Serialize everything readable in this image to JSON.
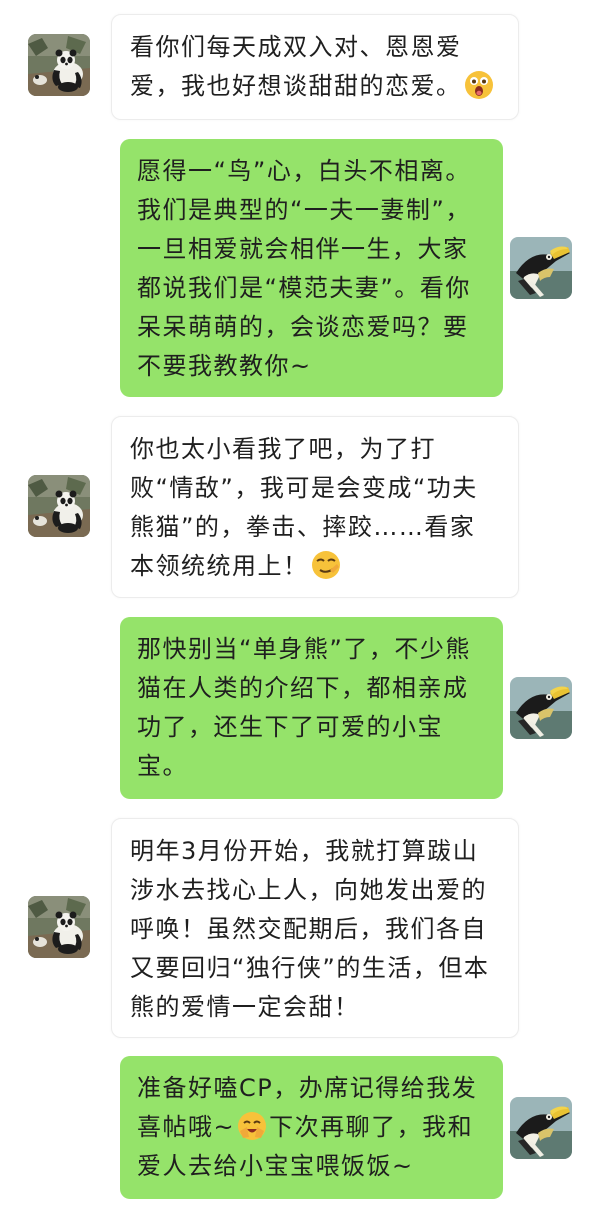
{
  "colors": {
    "incoming_bubble": "#ffffff",
    "outgoing_bubble": "#95e36a",
    "text": "#1f1f1f"
  },
  "participants": {
    "panda": {
      "avatar_icon": "panda-avatar-icon"
    },
    "hornbill": {
      "avatar_icon": "hornbill-avatar-icon"
    }
  },
  "messages": [
    {
      "sender": "panda",
      "side": "left",
      "text": "看你们每天成双入对、恩恩爱爱，我也好想谈甜甜的恋爱。",
      "emoji": "surprised-face-emoji"
    },
    {
      "sender": "hornbill",
      "side": "right",
      "text": "愿得一“鸟”心，白头不相离。我们是典型的“一夫一妻制”，一旦相爱就会相伴一生，大家都说我们是“模范夫妻”。看你呆呆萌萌的，会谈恋爱吗？要不要我教教你~"
    },
    {
      "sender": "panda",
      "side": "left",
      "text": "你也太小看我了吧，为了打败“情敌”，我可是会变成“功夫熊猫”的，拳击、摔跤……看家本领统统用上！",
      "emoji": "smug-face-emoji"
    },
    {
      "sender": "hornbill",
      "side": "right",
      "text": "那快别当“单身熊”了，不少熊猫在人类的介绍下，都相亲成功了，还生下了可爱的小宝宝。"
    },
    {
      "sender": "panda",
      "side": "left",
      "text": "明年3月份开始，我就打算跋山涉水去找心上人，向她发出爱的呼唤！虽然交配期后，我们各自又要回归“独行侠”的生活，但本熊的爱情一定会甜！"
    },
    {
      "sender": "hornbill",
      "side": "right",
      "text_before_emoji": "准备好嗑CP，办席记得给我发喜帖哦~",
      "emoji": "laughing-face-emoji",
      "text_after_emoji": "下次再聊了，我和爱人去给小宝宝喂饭饭~"
    }
  ]
}
